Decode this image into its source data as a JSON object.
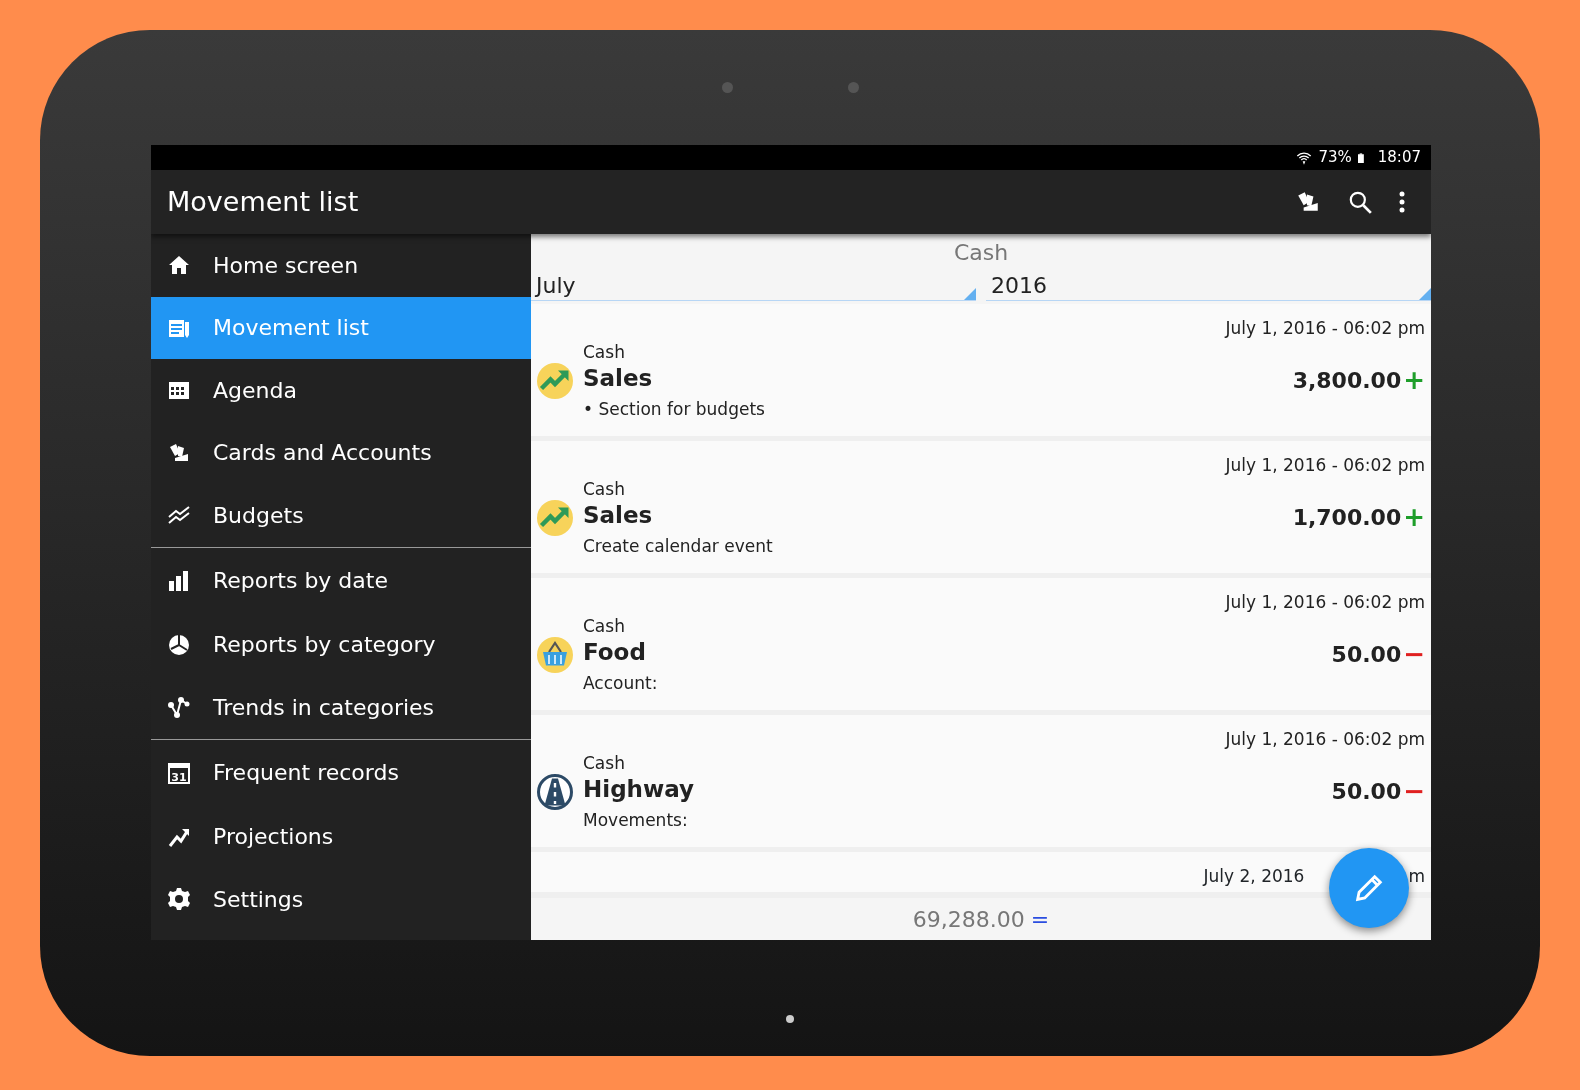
{
  "status_bar": {
    "battery": "73%",
    "time": "18:07"
  },
  "app_bar": {
    "title": "Movement list"
  },
  "sidebar": {
    "sections": [
      {
        "items": [
          {
            "label": "Home screen",
            "selected": false
          },
          {
            "label": "Movement list",
            "selected": true
          },
          {
            "label": "Agenda",
            "selected": false
          },
          {
            "label": "Cards and Accounts",
            "selected": false
          },
          {
            "label": "Budgets",
            "selected": false
          }
        ]
      },
      {
        "items": [
          {
            "label": "Reports by date",
            "selected": false
          },
          {
            "label": "Reports by category",
            "selected": false
          },
          {
            "label": "Trends in categories",
            "selected": false
          }
        ]
      },
      {
        "items": [
          {
            "label": "Frequent records",
            "selected": false,
            "icon_text": "31"
          },
          {
            "label": "Projections",
            "selected": false
          },
          {
            "label": "Settings",
            "selected": false
          }
        ]
      }
    ]
  },
  "filter": {
    "account": "Cash",
    "month": "July",
    "year": "2016"
  },
  "movements": [
    {
      "date": "July 1,  2016 - 06:02 pm",
      "account": "Cash",
      "category": "Sales",
      "note": "• Section for budgets",
      "amount": "3,800.00",
      "sign": "+",
      "kind": "income"
    },
    {
      "date": "July 1,  2016 - 06:02 pm",
      "account": "Cash",
      "category": "Sales",
      "note": "Create calendar event",
      "amount": "1,700.00",
      "sign": "+",
      "kind": "income"
    },
    {
      "date": "July 1,  2016 - 06:02 pm",
      "account": "Cash",
      "category": "Food",
      "note": "Account:",
      "amount": "50.00",
      "sign": "−",
      "kind": "expense"
    },
    {
      "date": "July 1,  2016 - 06:02 pm",
      "account": "Cash",
      "category": "Highway",
      "note": "Movements:",
      "amount": "50.00",
      "sign": "−",
      "kind": "expense"
    }
  ],
  "partial_row": {
    "date": "July 2,  2016",
    "date_tail": "m"
  },
  "total": {
    "amount": "69,288.00",
    "sign": "="
  }
}
